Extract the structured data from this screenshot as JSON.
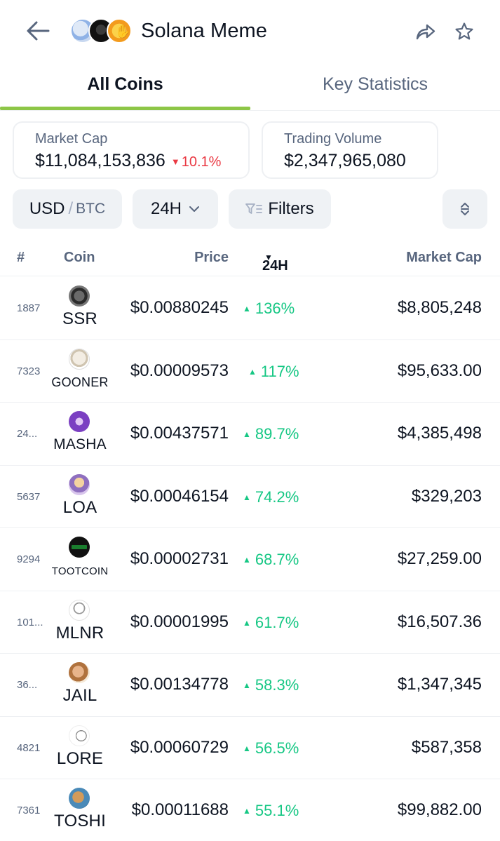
{
  "header": {
    "title": "Solana Meme"
  },
  "tabs": [
    {
      "label": "All Coins",
      "active": true
    },
    {
      "label": "Key Statistics",
      "active": false
    }
  ],
  "stats": {
    "market_cap": {
      "label": "Market Cap",
      "value": "$11,084,153,836",
      "change": "10.1%",
      "direction": "down"
    },
    "trading_volume": {
      "label": "Trading Volume",
      "value": "$2,347,965,080"
    }
  },
  "filters": {
    "currency_primary": "USD",
    "currency_sep": "/",
    "currency_secondary": "BTC",
    "timeframe": "24H",
    "filters_label": "Filters"
  },
  "table": {
    "headers": {
      "rank": "#",
      "coin": "Coin",
      "price": "Price",
      "change": "24H",
      "market_cap": "Market Cap"
    },
    "rows": [
      {
        "rank": "1887",
        "symbol": "SSR",
        "price": "$0.00880245",
        "change": "136%",
        "market_cap": "$8,805,248"
      },
      {
        "rank": "7323",
        "symbol": "GOONER",
        "price": "$0.00009573",
        "change": "117%",
        "market_cap": "$95,633.00"
      },
      {
        "rank": "24...",
        "symbol": "MASHA",
        "price": "$0.00437571",
        "change": "89.7%",
        "market_cap": "$4,385,498"
      },
      {
        "rank": "5637",
        "symbol": "LOA",
        "price": "$0.00046154",
        "change": "74.2%",
        "market_cap": "$329,203"
      },
      {
        "rank": "9294",
        "symbol": "TOOTCOIN",
        "price": "$0.00002731",
        "change": "68.7%",
        "market_cap": "$27,259.00"
      },
      {
        "rank": "101...",
        "symbol": "MLNR",
        "price": "$0.00001995",
        "change": "61.7%",
        "market_cap": "$16,507.36"
      },
      {
        "rank": "36...",
        "symbol": "JAIL",
        "price": "$0.00134778",
        "change": "58.3%",
        "market_cap": "$1,347,345"
      },
      {
        "rank": "4821",
        "symbol": "LORE",
        "price": "$0.00060729",
        "change": "56.5%",
        "market_cap": "$587,358"
      },
      {
        "rank": "7361",
        "symbol": "TOSHI",
        "price": "$0.00011688",
        "change": "55.1%",
        "market_cap": "$99,882.00"
      }
    ]
  },
  "colors": {
    "accent_tab": "#8dc647",
    "positive": "#16c784",
    "negative": "#ea3943",
    "muted_text": "#58667e"
  }
}
